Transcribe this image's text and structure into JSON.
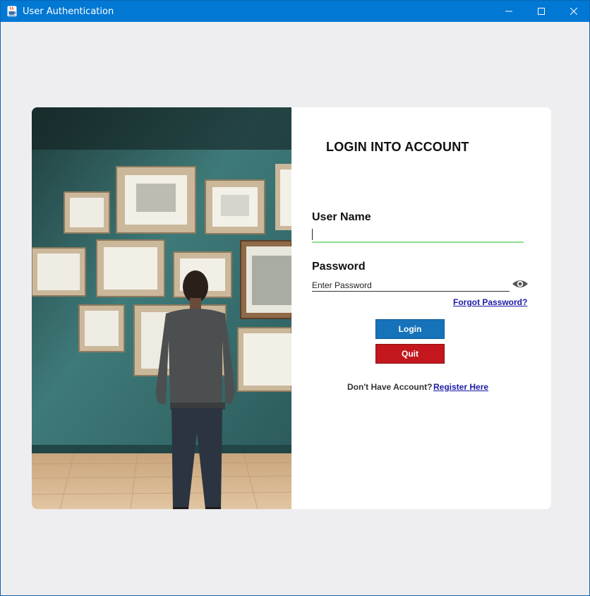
{
  "window": {
    "title": "User Authentication",
    "app_icon": "java-coffee-cup-icon",
    "controls": [
      "minimize-icon",
      "maximize-icon",
      "close-icon"
    ],
    "accent_color": "#0078d4"
  },
  "login": {
    "heading": "LOGIN INTO ACCOUNT",
    "username_label": "User Name",
    "username_value": "",
    "password_label": "Password",
    "password_placeholder": "Enter Password",
    "show_password_icon": "eye-icon",
    "forgot_link": "Forgot Password?",
    "login_button": "Login",
    "quit_button": "Quit",
    "no_account_text": "Don't Have Account?",
    "register_link": "Register Here"
  },
  "colors": {
    "login_button": "#1673ba",
    "quit_button": "#c3171d",
    "link": "#1a1aa6",
    "username_underline": "#8fe08f"
  }
}
